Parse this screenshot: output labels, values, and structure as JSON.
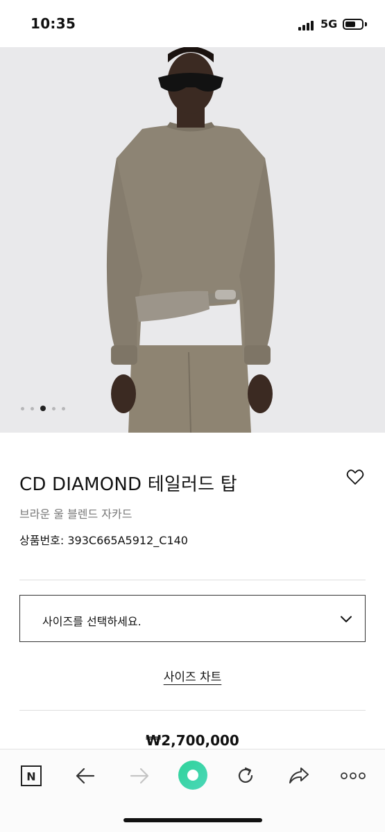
{
  "status_bar": {
    "time": "10:35",
    "network": "5G"
  },
  "product": {
    "image": {
      "description_icon": "product-photo",
      "background_color": "#e9e9eb",
      "garment_color": "#8d8474",
      "carousel_total": 5,
      "carousel_active": 3
    },
    "name": "CD DIAMOND 테일러드 탑",
    "subtitle": "브라운 울 블렌드 자카드",
    "code": "상품번호: 393C665A5912_C140",
    "wishlist_icon": "heart-icon"
  },
  "size_select": {
    "placeholder": "사이즈를 선택하세요.",
    "icon": "chevron-down-icon"
  },
  "size_chart_link": "사이즈 차트",
  "price": "₩2,700,000",
  "toolbar": {
    "items": [
      {
        "name": "naver-home-icon",
        "glyph": "N"
      },
      {
        "name": "back-icon"
      },
      {
        "name": "forward-icon"
      },
      {
        "name": "green-dot-icon",
        "color": "#3fd6a4"
      },
      {
        "name": "refresh-icon"
      },
      {
        "name": "share-icon"
      },
      {
        "name": "more-icon"
      }
    ]
  }
}
